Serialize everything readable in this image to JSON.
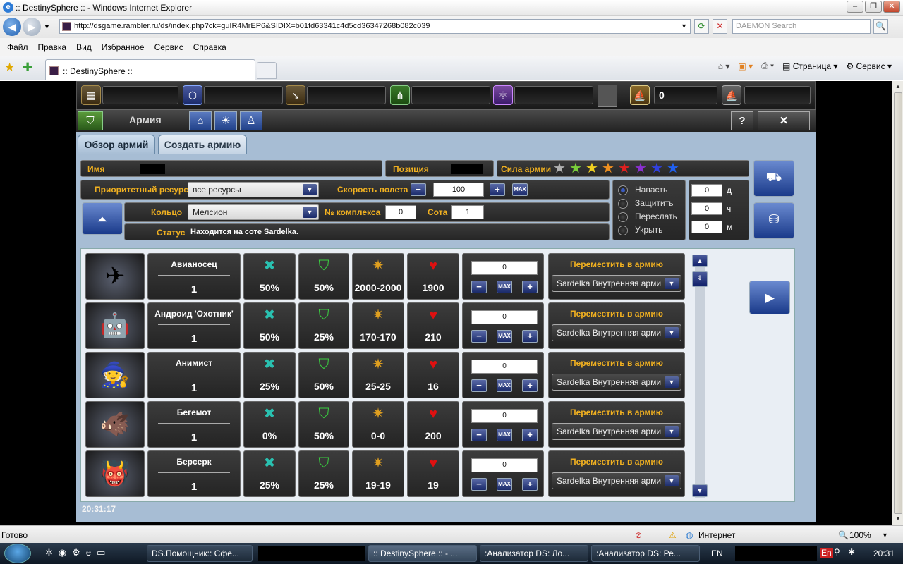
{
  "window": {
    "title": ":: DestinySphere :: - Windows Internet Explorer"
  },
  "address": {
    "url": "http://dsgame.rambler.ru/ds/index.php?ck=guIR4MrEP6&SIDIX=b01fd63341c4d5cd36347268b082c039",
    "search_placeholder": "DAEMON Search"
  },
  "menu": [
    "Файл",
    "Правка",
    "Вид",
    "Избранное",
    "Сервис",
    "Справка"
  ],
  "tab": {
    "title": ":: DestinySphere ::"
  },
  "toolbar": {
    "page": "Страница",
    "tools": "Сервис"
  },
  "status": {
    "left": "Готово",
    "zone": "Интернет",
    "zoom": "100%"
  },
  "taskbar": {
    "tasks": [
      "DS.Помощник:: Сфе...",
      ":: DestinySphere :: - ...",
      ":Анализатор DS: Ло...",
      ":Анализатор DS: Ре..."
    ],
    "lang": "EN",
    "clock": "20:31",
    "tray_lang": "En"
  },
  "game": {
    "resource_count": "0",
    "panel_title": "Армия",
    "help": "?",
    "close": "✕",
    "tabs": [
      "Обзор армий",
      "Создать армию"
    ],
    "labels": {
      "name": "Имя",
      "position": "Позиция",
      "strength": "Сила армии",
      "priority": "Приоритетный ресурс",
      "speed": "Скорость полета",
      "ring": "Кольцо",
      "complex": "№ комплекса",
      "cell": "Сота",
      "status": "Статус"
    },
    "priority_value": "все ресурсы",
    "speed_value": "100",
    "ring_value": "Мелсион",
    "complex_value": "0",
    "cell_value": "1",
    "status_value": "Находится на соте Sardelka.",
    "max": "MAX",
    "actions": [
      "Напасть",
      "Защитить",
      "Переслать",
      "Укрыть"
    ],
    "time_fields": [
      {
        "value": "0",
        "unit": "д"
      },
      {
        "value": "0",
        "unit": "ч"
      },
      {
        "value": "0",
        "unit": "м"
      }
    ],
    "stars_colors": [
      "#b0b0b0",
      "#7ad03a",
      "#f0d020",
      "#f09020",
      "#e02020",
      "#8a30d0",
      "#3040e0",
      "#2060f0"
    ],
    "move_label": "Переместить в армию",
    "move_target": "Sardelka Внутренняя арми",
    "units": [
      {
        "name": "Авианосец",
        "count": "1",
        "attack": "50%",
        "defense": "50%",
        "damage": "2000-2000",
        "hp": "1900",
        "qty": "0",
        "fig": "✈"
      },
      {
        "name": "Андроид 'Охотник'",
        "count": "1",
        "attack": "50%",
        "defense": "25%",
        "damage": "170-170",
        "hp": "210",
        "qty": "0",
        "fig": "🤖"
      },
      {
        "name": "Анимист",
        "count": "1",
        "attack": "25%",
        "defense": "50%",
        "damage": "25-25",
        "hp": "16",
        "qty": "0",
        "fig": "🧙"
      },
      {
        "name": "Бегемот",
        "count": "1",
        "attack": "0%",
        "defense": "50%",
        "damage": "0-0",
        "hp": "200",
        "qty": "0",
        "fig": "🐗"
      },
      {
        "name": "Берсерк",
        "count": "1",
        "attack": "25%",
        "defense": "25%",
        "damage": "19-19",
        "hp": "19",
        "qty": "0",
        "fig": "👹"
      }
    ],
    "clock": "20:31:17"
  }
}
